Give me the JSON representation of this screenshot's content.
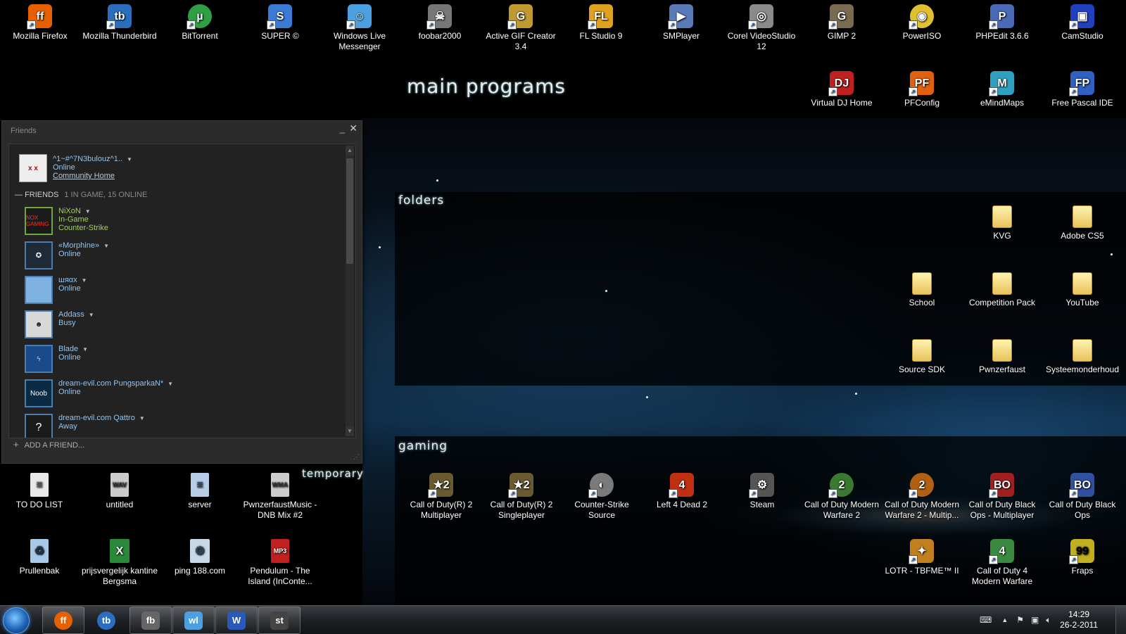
{
  "headings": {
    "main_programs": "main programs",
    "folders": "folders",
    "gaming": "gaming",
    "temporary": "temporary"
  },
  "main_programs": [
    {
      "label": "Mozilla Firefox",
      "icon": "firefox-icon",
      "color": "#e66000"
    },
    {
      "label": "Mozilla Thunderbird",
      "icon": "thunderbird-icon",
      "color": "#2a6ebd"
    },
    {
      "label": "BitTorrent",
      "icon": "bittorrent-icon",
      "color": "#2f9e44"
    },
    {
      "label": "SUPER ©",
      "icon": "super-icon",
      "color": "#3a7bd5"
    },
    {
      "label": "Windows Live Messenger",
      "icon": "messenger-icon",
      "color": "#4aa0e0"
    },
    {
      "label": "foobar2000",
      "icon": "foobar-icon",
      "color": "#777777"
    },
    {
      "label": "Active GIF Creator 3.4",
      "icon": "gif-creator-icon",
      "color": "#c09a30"
    },
    {
      "label": "FL Studio 9",
      "icon": "flstudio-icon",
      "color": "#e0a020"
    },
    {
      "label": "SMPlayer",
      "icon": "smplayer-icon",
      "color": "#5a7ab8"
    },
    {
      "label": "Corel VideoStudio 12",
      "icon": "videostudio-icon",
      "color": "#8a8a8a"
    },
    {
      "label": "GIMP 2",
      "icon": "gimp-icon",
      "color": "#7a6a50"
    },
    {
      "label": "PowerISO",
      "icon": "poweriso-icon",
      "color": "#e0c030"
    },
    {
      "label": "PHPEdit 3.6.6",
      "icon": "phpedit-icon",
      "color": "#4a6ab8"
    },
    {
      "label": "CamStudio",
      "icon": "camstudio-icon",
      "color": "#2040c0"
    },
    {
      "label": "Virtual DJ Home",
      "icon": "virtualdj-icon",
      "color": "#c02020"
    },
    {
      "label": "PFConfig",
      "icon": "pfconfig-icon",
      "color": "#e06010"
    },
    {
      "label": "eMindMaps",
      "icon": "emindmaps-icon",
      "color": "#30a0c0"
    },
    {
      "label": "Free Pascal IDE",
      "icon": "freepascal-icon",
      "color": "#3060c0"
    }
  ],
  "folders": [
    {
      "label": "KVG"
    },
    {
      "label": "Adobe CS5"
    },
    {
      "label": "School"
    },
    {
      "label": "Competition Pack"
    },
    {
      "label": "YouTube"
    },
    {
      "label": "Source SDK"
    },
    {
      "label": "Pwnzerfaust"
    },
    {
      "label": "Systeemonderhoud"
    }
  ],
  "gaming": [
    {
      "label": "Call of Duty(R) 2 Multiplayer",
      "icon": "cod2-mp-icon",
      "color": "#6a5a30"
    },
    {
      "label": "Call of Duty(R) 2 Singleplayer",
      "icon": "cod2-sp-icon",
      "color": "#6a5a30"
    },
    {
      "label": "Counter-Strike Source",
      "icon": "css-icon",
      "color": "#7a7a7a"
    },
    {
      "label": "Left 4 Dead 2",
      "icon": "l4d2-icon",
      "color": "#c03010"
    },
    {
      "label": "Steam",
      "icon": "steam-icon",
      "color": "#555555"
    },
    {
      "label": "Call of Duty Modern Warfare 2",
      "icon": "mw2-icon",
      "color": "#3a7a30"
    },
    {
      "label": "Call of Duty Modern Warfare 2 - Multip...",
      "icon": "mw2-mp-icon",
      "color": "#b06010"
    },
    {
      "label": "Call of Duty Black Ops - Multiplayer",
      "icon": "blackops-mp-icon",
      "color": "#a02020"
    },
    {
      "label": "Call of Duty Black Ops",
      "icon": "blackops-icon",
      "color": "#3050a0"
    },
    {
      "label": "LOTR - TBFME™ II",
      "icon": "lotr-icon",
      "color": "#c08020"
    },
    {
      "label": "Call of Duty 4 Modern Warfare",
      "icon": "cod4-icon",
      "color": "#3a8a40"
    },
    {
      "label": "Fraps",
      "icon": "fraps-icon",
      "color": "#c0b020"
    }
  ],
  "temporary": [
    {
      "label": "TO DO LIST",
      "icon": "text-file-icon",
      "color": "#e8e8e8"
    },
    {
      "label": "untitled",
      "icon": "wav-file-icon",
      "color": "#cccccc"
    },
    {
      "label": "server",
      "icon": "document-icon",
      "color": "#b8cde8"
    },
    {
      "label": "PwnzerfaustMusic - DNB Mix #2",
      "icon": "wma-file-icon",
      "color": "#cccccc"
    },
    {
      "label": "Prullenbak",
      "icon": "recycle-bin-icon",
      "color": "#a8c8e8"
    },
    {
      "label": "prijsvergelijk kantine Bergsma",
      "icon": "excel-file-icon",
      "color": "#2a8a3a"
    },
    {
      "label": "ping 188.com",
      "icon": "settings-file-icon",
      "color": "#c8d8e8"
    },
    {
      "label": "Pendulum - The Island (InConte...",
      "icon": "mp3-file-icon",
      "color": "#c02020"
    }
  ],
  "friends_window": {
    "title": "Friends",
    "me": {
      "name": "^1~#^7N3bulouz^1..",
      "status": "Online",
      "link": "Community Home"
    },
    "section_label": "FRIENDS",
    "section_count": "1 IN GAME, 15 ONLINE",
    "friends": [
      {
        "name": "NiXoN",
        "status": "In-Game",
        "game": "Counter-Strike",
        "avatar": "NOX GAMING"
      },
      {
        "name": "«Morphine»",
        "status": "Online",
        "game": "",
        "avatar": ""
      },
      {
        "name": "шяαх",
        "status": "Online",
        "game": "",
        "avatar": ""
      },
      {
        "name": "Addass",
        "status": "Busy",
        "game": "",
        "avatar": ""
      },
      {
        "name": "Blade",
        "status": "Online",
        "game": "",
        "avatar": ""
      },
      {
        "name": "dream-evil.com PungsparkaN*",
        "status": "Online",
        "game": "",
        "avatar": "Noob"
      },
      {
        "name": "dream-evil.com Qattro",
        "status": "Away",
        "game": "",
        "avatar": "?"
      }
    ],
    "add_friend": "ADD A FRIEND..."
  },
  "taskbar": {
    "buttons": [
      {
        "icon": "firefox-icon",
        "color": "#e66000",
        "glyph": "ff"
      },
      {
        "icon": "thunderbird-icon",
        "color": "#2a6ebd",
        "glyph": "tb"
      },
      {
        "icon": "foobar-icon",
        "color": "#666666",
        "glyph": "fb"
      },
      {
        "icon": "messenger-icon",
        "color": "#4aa0e0",
        "glyph": "wl"
      },
      {
        "icon": "word-icon",
        "color": "#2a5ab8",
        "glyph": "W"
      },
      {
        "icon": "steam-icon",
        "color": "#444444",
        "glyph": "st"
      }
    ],
    "time": "14:29",
    "date": "26-2-2011"
  }
}
